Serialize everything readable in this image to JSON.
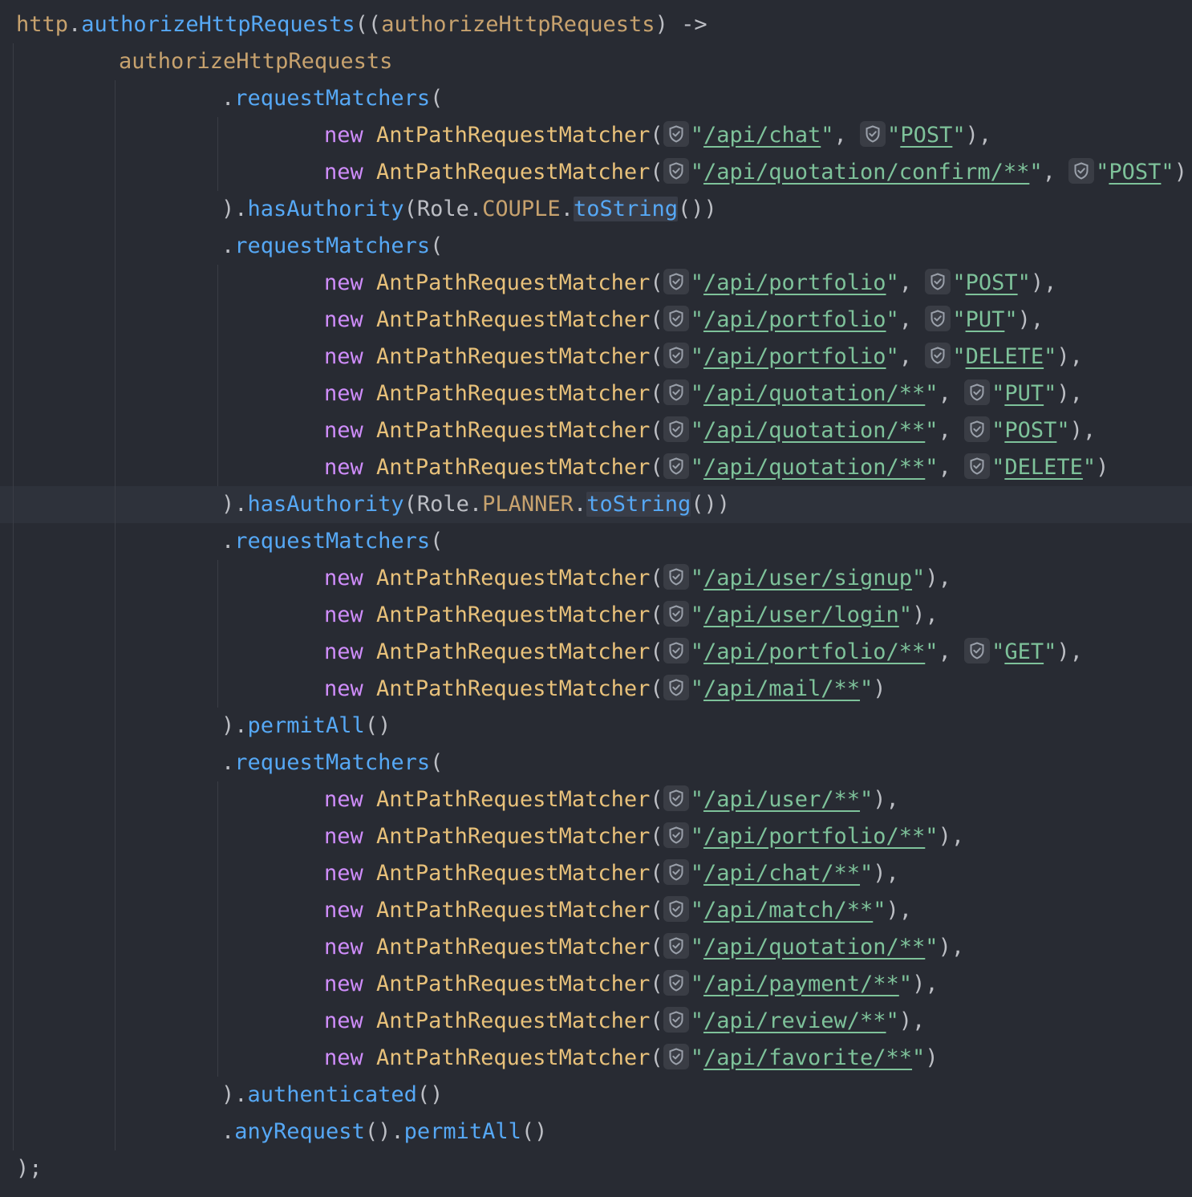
{
  "code": {
    "receiver": "http",
    "dot": ".",
    "authorize_method": "authorizeHttpRequests",
    "open_lambda": "((",
    "lambda_param": "authorizeHttpRequests",
    "arrow": ") ->",
    "lambda_body_var": "authorizeHttpRequests",
    "request_matchers": ".requestMatchers(",
    "new_kw": "new",
    "matcher_class": "AntPathRequestMatcher",
    "open_paren": "(",
    "quote": "\"",
    "comma": ", ",
    "close_comma": "),",
    "close": ")",
    "close_paren_dot": ").",
    "has_authority": "hasAuthority",
    "role_open": "(Role.",
    "to_string": "toString",
    "double_close": "())",
    "permit_all": "permitAll",
    "authenticated": "authenticated",
    "empty_call": "()",
    "any_request": ".anyRequest",
    "paren_dot": "().",
    "final": ");",
    "roles": {
      "couple": "COUPLE",
      "planner": "PLANNER"
    },
    "groups": [
      {
        "matchers": [
          {
            "path": "/api/chat",
            "method": "POST"
          },
          {
            "path": "/api/quotation/confirm/**",
            "method": "POST"
          }
        ],
        "terminal": "couple"
      },
      {
        "matchers": [
          {
            "path": "/api/portfolio",
            "method": "POST"
          },
          {
            "path": "/api/portfolio",
            "method": "PUT"
          },
          {
            "path": "/api/portfolio",
            "method": "DELETE"
          },
          {
            "path": "/api/quotation/**",
            "method": "PUT"
          },
          {
            "path": "/api/quotation/**",
            "method": "POST"
          },
          {
            "path": "/api/quotation/**",
            "method": "DELETE"
          }
        ],
        "terminal": "planner"
      },
      {
        "matchers": [
          {
            "path": "/api/user/signup"
          },
          {
            "path": "/api/user/login"
          },
          {
            "path": "/api/portfolio/**",
            "method": "GET"
          },
          {
            "path": "/api/mail/**"
          }
        ],
        "terminal": "permitAll"
      },
      {
        "matchers": [
          {
            "path": "/api/user/**"
          },
          {
            "path": "/api/portfolio/**"
          },
          {
            "path": "/api/chat/**"
          },
          {
            "path": "/api/match/**"
          },
          {
            "path": "/api/quotation/**"
          },
          {
            "path": "/api/payment/**"
          },
          {
            "path": "/api/review/**"
          },
          {
            "path": "/api/favorite/**"
          }
        ],
        "terminal": "authenticated"
      }
    ]
  },
  "colors": {
    "background": "#282b33",
    "keyword": "#cf8dfb",
    "method": "#56a8f5",
    "class": "#e8c17a",
    "variable": "#c7a26e",
    "string": "#7ec29a",
    "default": "#bcbec4"
  },
  "icons": {
    "inlay_hint": "shield-check-icon"
  }
}
